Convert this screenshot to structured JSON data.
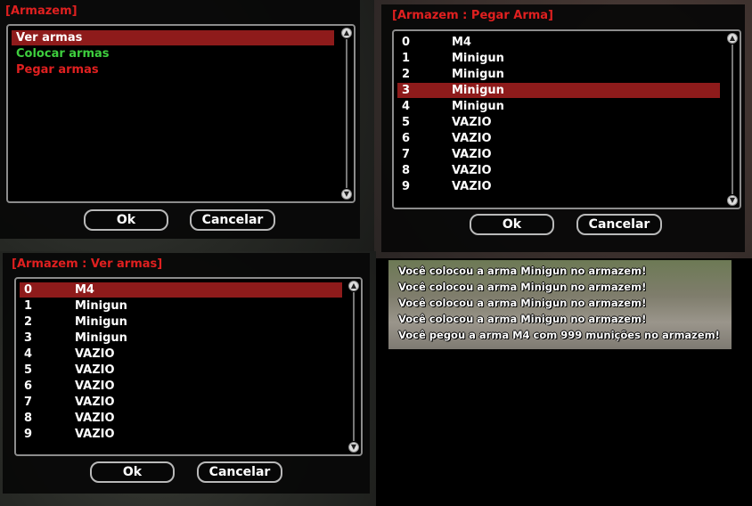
{
  "dialog_armazem": {
    "title": "[Armazem]",
    "items": [
      {
        "label": "Ver armas",
        "color": "#ffffff",
        "selected": true
      },
      {
        "label": "Colocar armas",
        "color": "#3ecf3e",
        "selected": false
      },
      {
        "label": "Pegar armas",
        "color": "#e02020",
        "selected": false
      }
    ],
    "ok_label": "Ok",
    "cancel_label": "Cancelar"
  },
  "dialog_pegar": {
    "title": "[Armazem : Pegar Arma]",
    "rows": [
      {
        "slot": "0",
        "weapon": "M4"
      },
      {
        "slot": "1",
        "weapon": "Minigun"
      },
      {
        "slot": "2",
        "weapon": "Minigun"
      },
      {
        "slot": "3",
        "weapon": "Minigun"
      },
      {
        "slot": "4",
        "weapon": "Minigun"
      },
      {
        "slot": "5",
        "weapon": "VAZIO"
      },
      {
        "slot": "6",
        "weapon": "VAZIO"
      },
      {
        "slot": "7",
        "weapon": "VAZIO"
      },
      {
        "slot": "8",
        "weapon": "VAZIO"
      },
      {
        "slot": "9",
        "weapon": "VAZIO"
      }
    ],
    "selected_index": 3,
    "ok_label": "Ok",
    "cancel_label": "Cancelar"
  },
  "dialog_ver": {
    "title": "[Armazem : Ver armas]",
    "rows": [
      {
        "slot": "0",
        "weapon": "M4"
      },
      {
        "slot": "1",
        "weapon": "Minigun"
      },
      {
        "slot": "2",
        "weapon": "Minigun"
      },
      {
        "slot": "3",
        "weapon": "Minigun"
      },
      {
        "slot": "4",
        "weapon": "VAZIO"
      },
      {
        "slot": "5",
        "weapon": "VAZIO"
      },
      {
        "slot": "6",
        "weapon": "VAZIO"
      },
      {
        "slot": "7",
        "weapon": "VAZIO"
      },
      {
        "slot": "8",
        "weapon": "VAZIO"
      },
      {
        "slot": "9",
        "weapon": "VAZIO"
      }
    ],
    "selected_index": 0,
    "ok_label": "Ok",
    "cancel_label": "Cancelar"
  },
  "chat": {
    "lines": [
      "Você colocou a arma Minigun no armazem!",
      "Você colocou a arma Minigun no armazem!",
      "Você colocou a arma Minigun no armazem!",
      "Você colocou a arma Minigun no armazem!",
      "Você pegou a arma M4 com 999 munições no armazem!"
    ]
  },
  "colors": {
    "title_red": "#e02020",
    "selection": "#8e1b1b"
  }
}
